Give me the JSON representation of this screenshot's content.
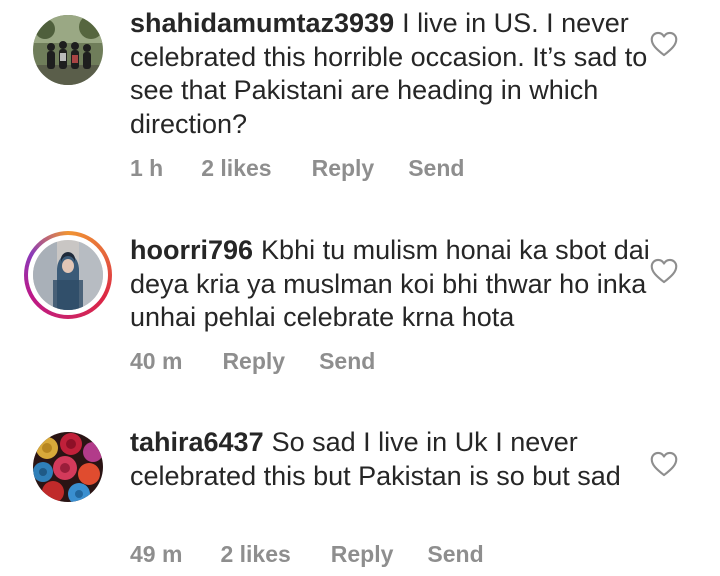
{
  "comments": [
    {
      "username": "shahidamumtaz3939",
      "text": "I live in US. I never celebrated this horrible occasion. It’s sad to see that Pakistani  are heading in which direction?",
      "time": "1 h",
      "likes": "2 likes",
      "reply_label": "Reply",
      "send_label": "Send",
      "avatar_icon": "group-photo-avatar",
      "has_story": false
    },
    {
      "username": "hoorri796",
      "text": "Kbhi tu mulism honai ka sbot dai deya kria ya muslman koi bhi thwar ho inka unhai pehlai celebrate krna hota",
      "time": "40 m",
      "likes": "",
      "reply_label": "Reply",
      "send_label": "Send",
      "avatar_icon": "portrait-avatar",
      "has_story": true
    },
    {
      "username": "tahira6437",
      "text": "So sad  I live in Uk I never celebrated this but Pakistan is so  but sad",
      "time": "49 m",
      "likes": "2 likes",
      "reply_label": "Reply",
      "send_label": "Send",
      "avatar_icon": "roses-avatar",
      "has_story": false
    }
  ],
  "colors": {
    "text": "#262626",
    "meta": "#8e8e8e",
    "story_ring": "#dc2743"
  }
}
